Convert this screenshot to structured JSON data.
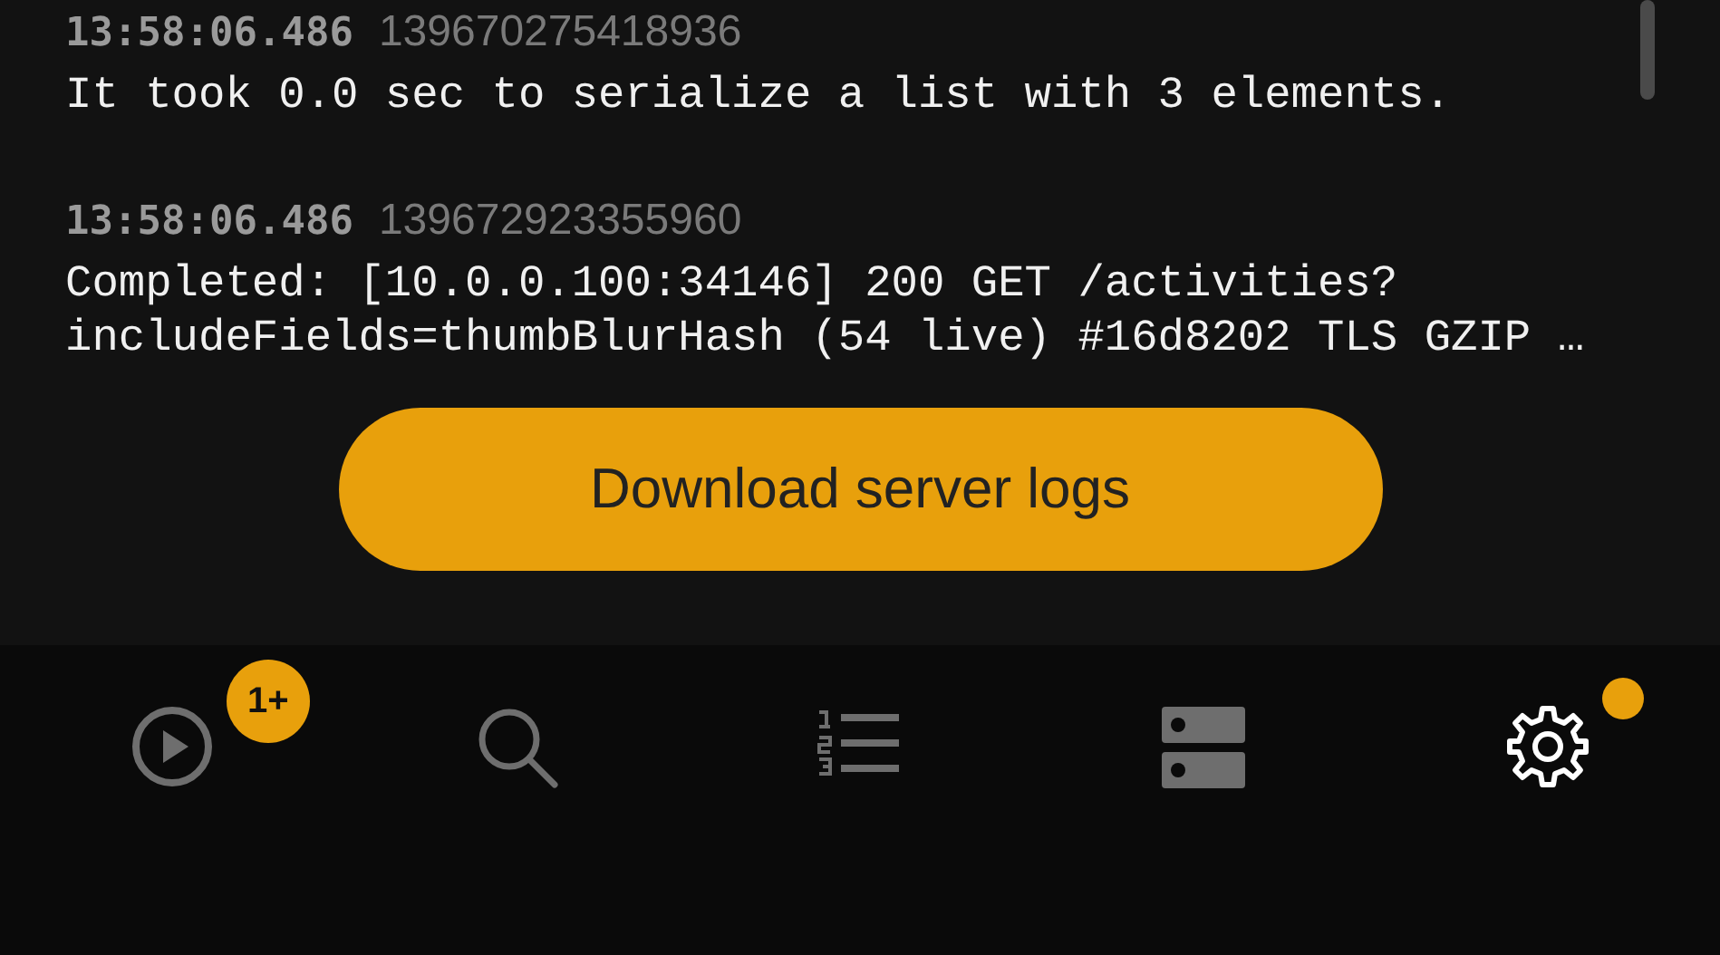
{
  "log_entries": [
    {
      "time": "13:58:06.486",
      "thread": "139670275418936",
      "message": "It took 0.0 sec to serialize a list with 3 elements."
    },
    {
      "time": "13:58:06.486",
      "thread": "139672923355960",
      "message": "Completed: [10.0.0.100:34146] 200 GET /activities?\nincludeFields=thumbBlurHash (54 live) #16d8202 TLS GZIP …"
    }
  ],
  "download_button": "Download server logs",
  "nav_items": [
    {
      "kind": "now_playing",
      "selected": false,
      "badge": "1+"
    },
    {
      "kind": "search",
      "selected": false
    },
    {
      "kind": "queue",
      "selected": false
    },
    {
      "kind": "servers",
      "selected": false
    },
    {
      "kind": "settings",
      "selected": true,
      "dot": true
    }
  ]
}
